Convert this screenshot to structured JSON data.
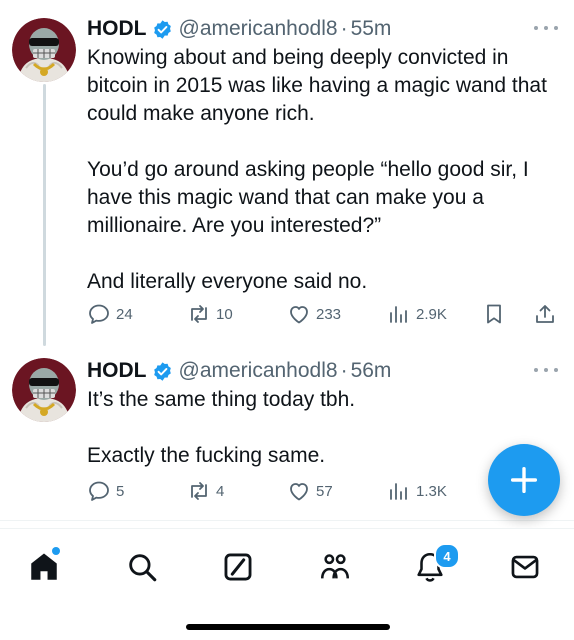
{
  "tweets": [
    {
      "author": {
        "name": "HODL",
        "handle": "@americanhodl8",
        "separator": "·",
        "time": "55m"
      },
      "text": "Knowing about and being deeply convicted in bitcoin in 2015 was like having a magic wand that could make anyone rich.\n\nYou’d go around asking people “hello good sir, I have this magic wand that can make you a millionaire. Are you interested?”\n\nAnd literally everyone said no.",
      "stats": {
        "replies": "24",
        "reposts": "10",
        "likes": "233",
        "views": "2.9K"
      }
    },
    {
      "author": {
        "name": "HODL",
        "handle": "@americanhodl8",
        "separator": "·",
        "time": "56m"
      },
      "text": "It’s the same thing today tbh.\n\nExactly the fucking same.",
      "stats": {
        "replies": "5",
        "reposts": "4",
        "likes": "57",
        "views": "1.3K"
      }
    }
  ],
  "fab": {
    "icon": "plus-icon"
  },
  "bottom_nav": {
    "items": [
      {
        "name": "home",
        "icon": "home-icon",
        "active": true
      },
      {
        "name": "search",
        "icon": "search-icon"
      },
      {
        "name": "grok",
        "icon": "grok-icon"
      },
      {
        "name": "communities",
        "icon": "people-icon"
      },
      {
        "name": "notifications",
        "icon": "bell-icon",
        "badge": "4"
      },
      {
        "name": "messages",
        "icon": "mail-icon"
      }
    ]
  },
  "colors": {
    "accent": "#1d9bf0",
    "text": "#0f1419",
    "secondary": "#536471",
    "avatar_bg": "#6b1522"
  }
}
